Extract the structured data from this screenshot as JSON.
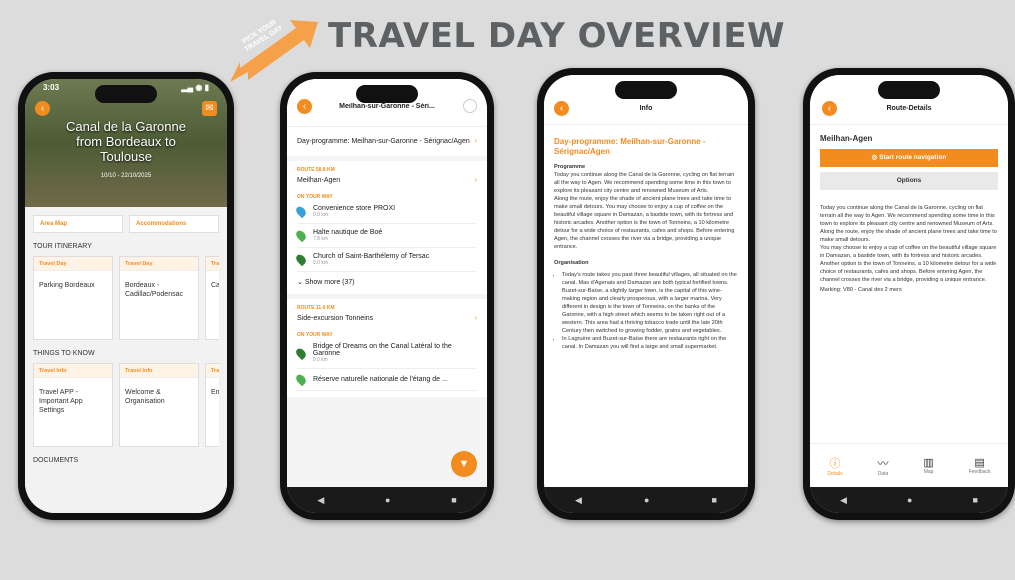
{
  "slide_title": "TRAVEL DAY OVERVIEW",
  "callout": "PICK YOUR TRAVEL DAY",
  "phone1": {
    "time": "3:03",
    "hero_title_lines": [
      "Canal de la Garonne",
      "from Bordeaux to",
      "Toulouse"
    ],
    "hero_date": "10/10 - 22/10/2025",
    "pills": [
      "Area Map",
      "Accommodations"
    ],
    "itinerary_heading": "TOUR ITINERARY",
    "itinerary": [
      {
        "tag": "Travel Day",
        "text": "Parking Bordeaux"
      },
      {
        "tag": "Travel Day",
        "text": "Bordeaux - Cadillac/Podensac"
      },
      {
        "tag": "Tra",
        "text": "Ca Mo Ge"
      }
    ],
    "know_heading": "THINGS TO KNOW",
    "know": [
      {
        "tag": "Travel Info",
        "text": "Travel APP - Important App Settings"
      },
      {
        "tag": "Travel Info",
        "text": "Welcome & Organisation"
      },
      {
        "tag": "Tra",
        "text": "Em Nu"
      }
    ],
    "docs_heading": "DOCUMENTS"
  },
  "phone2": {
    "header": "Meilhan-sur-Garonne - Séri...",
    "programme": "Day-programme: Meilhan-sur-Garonne - Sérignac/Agen",
    "route1_label": "ROUTE 58.8 KM",
    "route1_name": "Meilhan-Agen",
    "onway": "ON YOUR WAY",
    "pois": [
      {
        "name": "Convenience store PROXI",
        "dist": "0.0 km",
        "color": "#3aa0d8"
      },
      {
        "name": "Halte nautique de Boé",
        "dist": "7.8 km",
        "color": "#4caf50"
      },
      {
        "name": "Church of Saint-Barthélemy of Tersac",
        "dist": "9.0 km",
        "color": "#2e7d32"
      }
    ],
    "show_more": "Show more (37)",
    "route2_label": "ROUTE 11.6 KM",
    "route2_name": "Side-excursion Tonneins",
    "onway2": "ON YOUR WAY",
    "pois2": [
      {
        "name": "Bridge of Dreams on the Canal Latéral to the Garonne",
        "dist": "0.0 km",
        "color": "#2e7d32"
      },
      {
        "name": "Réserve naturelle nationale de l'étang de ...",
        "dist": "",
        "color": "#4caf50"
      }
    ]
  },
  "phone3": {
    "header": "Info",
    "heading": "Day-programme: Meilhan-sur-Garonne - Sérignac/Agen",
    "programme_title": "Programme",
    "p1": "Today you continue along the Canal de la Garonne, cycling on flat terrain all the way to Agen. We recommend spending some time in this town to explore its pleasant city centre and renowned Museum of Arts.",
    "p2": "Along the route, enjoy the shade of ancient plane trees and take time to make small detours. You may choose to enjoy a cup of coffee on the beautiful village square in Damazan, a bastide town, with its fortress and historic arcades. Another option is the town of Tonneins, a 10 kilometre detour for a wide choice of restaurants, cafes and shops. Before entering Agen, the channel crosses the river via a bridge, providing a unique entrance.",
    "org_title": "Organisation",
    "bullet1": "Today's route takes you past three beautiful villages, all situated on the canal. Mas d'Agenais and Damazan are both typical fortified towns. Buzet-sur-Baïse, a slightly larger town, is the capital of this wine-making region and clearly prosperous, with a larger marina. Very different in design is the town of Tonneins, on the banks of the Garonne, with a high street which seems to be taken right out of a western. This area had a thriving tobacco trade until the late 20th Century then switched to growing fodder, grains and vegetables.",
    "bullet2": "In Lagruère and Buzet-sur-Baïse there are restaurants right on the canal. In Damazan you will find a large and small supermarket."
  },
  "phone4": {
    "header": "Route-Details",
    "route_name": "Meilhan-Agen",
    "start_btn": "Start route navigation",
    "options_btn": "Options",
    "desc": "Today you continue along the Canal de la Garonne, cycling on flat terrain all the way to Agen. We recommend spending some time in this town to explore its pleasant city centre and renowned Museum of Arts. Along the route, enjoy the shade of ancient plane trees and take time to make small detours.",
    "desc2": "You may choose to enjoy a cup of coffee on the beautiful village square in Damazan, a bastide town, with its fortress and historic arcades. Another option is the town of Tonneins, a 10 kilometre detour for a wide choice of restaurants, cafes and shops. Before entering Agen, the channel crosses the river via a bridge, providing a unique entrance.",
    "marking": "Marking: V80 - Canal des 2 mers",
    "tabs": [
      "Details",
      "Data",
      "Map",
      "Feedback"
    ]
  }
}
